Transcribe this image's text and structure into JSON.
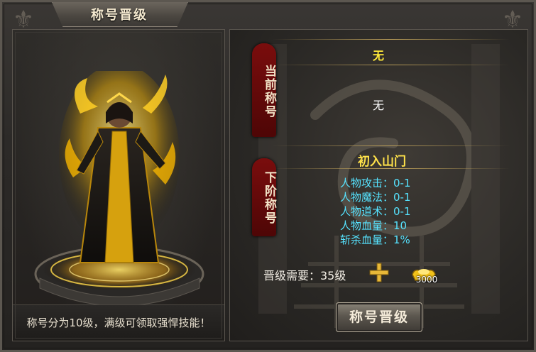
{
  "window": {
    "title": "称号晋级"
  },
  "left": {
    "footer": "称号分为10级，满级可领取强悍技能！"
  },
  "current": {
    "banner": "当前称号",
    "title": "无",
    "attributes": "无"
  },
  "next": {
    "banner": "下阶称号",
    "title": "初入山门",
    "stats": [
      {
        "text": "人物攻击：0-1"
      },
      {
        "text": "人物魔法：0-1"
      },
      {
        "text": "人物道术：0-1"
      },
      {
        "text": "人物血量：10"
      },
      {
        "text": "斩杀血量：1%"
      }
    ]
  },
  "requirement": {
    "label": "晋级需要：35级",
    "gold_amount": "3000",
    "plus_icon": "plus-icon",
    "gold_icon": "gold-ingot-icon"
  },
  "button": {
    "label": "称号晋级"
  },
  "colors": {
    "accent_gold": "#ffe24a",
    "stat_cyan": "#56e3ff",
    "banner_red": "#7a0d0d"
  }
}
